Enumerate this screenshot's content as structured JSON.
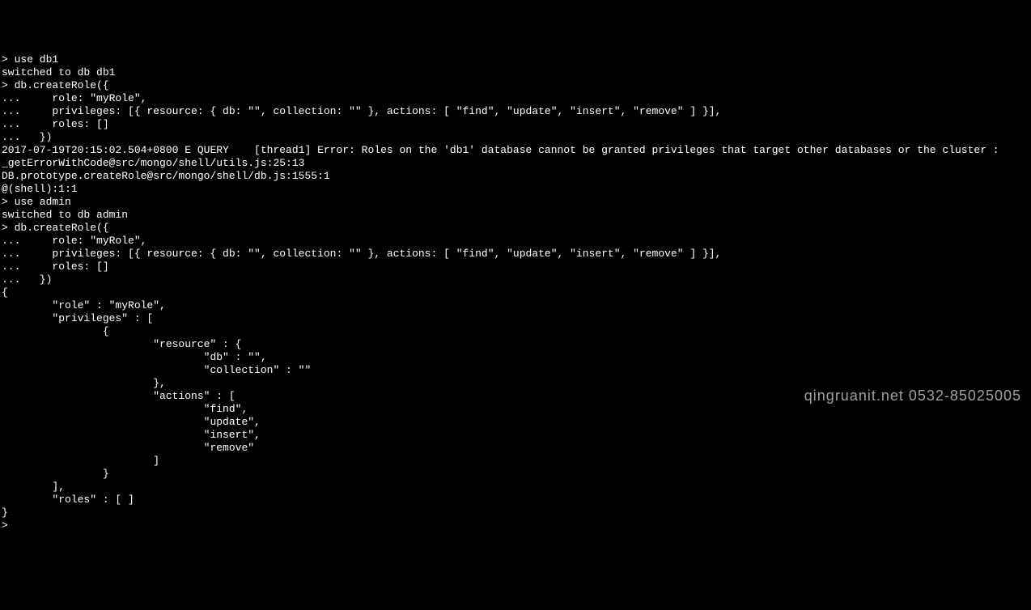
{
  "terminal": {
    "lines": [
      "> use db1",
      "switched to db db1",
      "> db.createRole({",
      "...     role: \"myRole\",",
      "...     privileges: [{ resource: { db: \"\", collection: \"\" }, actions: [ \"find\", \"update\", \"insert\", \"remove\" ] }],",
      "...     roles: []",
      "...   })",
      "2017-07-19T20:15:02.504+0800 E QUERY    [thread1] Error: Roles on the 'db1' database cannot be granted privileges that target other databases or the cluster :",
      "_getErrorWithCode@src/mongo/shell/utils.js:25:13",
      "DB.prototype.createRole@src/mongo/shell/db.js:1555:1",
      "@(shell):1:1",
      "> use admin",
      "switched to db admin",
      "> db.createRole({",
      "...     role: \"myRole\",",
      "...     privileges: [{ resource: { db: \"\", collection: \"\" }, actions: [ \"find\", \"update\", \"insert\", \"remove\" ] }],",
      "...     roles: []",
      "...   })",
      "{",
      "        \"role\" : \"myRole\",",
      "        \"privileges\" : [",
      "                {",
      "                        \"resource\" : {",
      "                                \"db\" : \"\",",
      "                                \"collection\" : \"\"",
      "                        },",
      "                        \"actions\" : [",
      "                                \"find\",",
      "                                \"update\",",
      "                                \"insert\",",
      "                                \"remove\"",
      "                        ]",
      "                }",
      "        ],",
      "        \"roles\" : [ ]",
      "}",
      ">"
    ]
  },
  "watermark": {
    "text": "qingruanit.net 0532-85025005"
  }
}
